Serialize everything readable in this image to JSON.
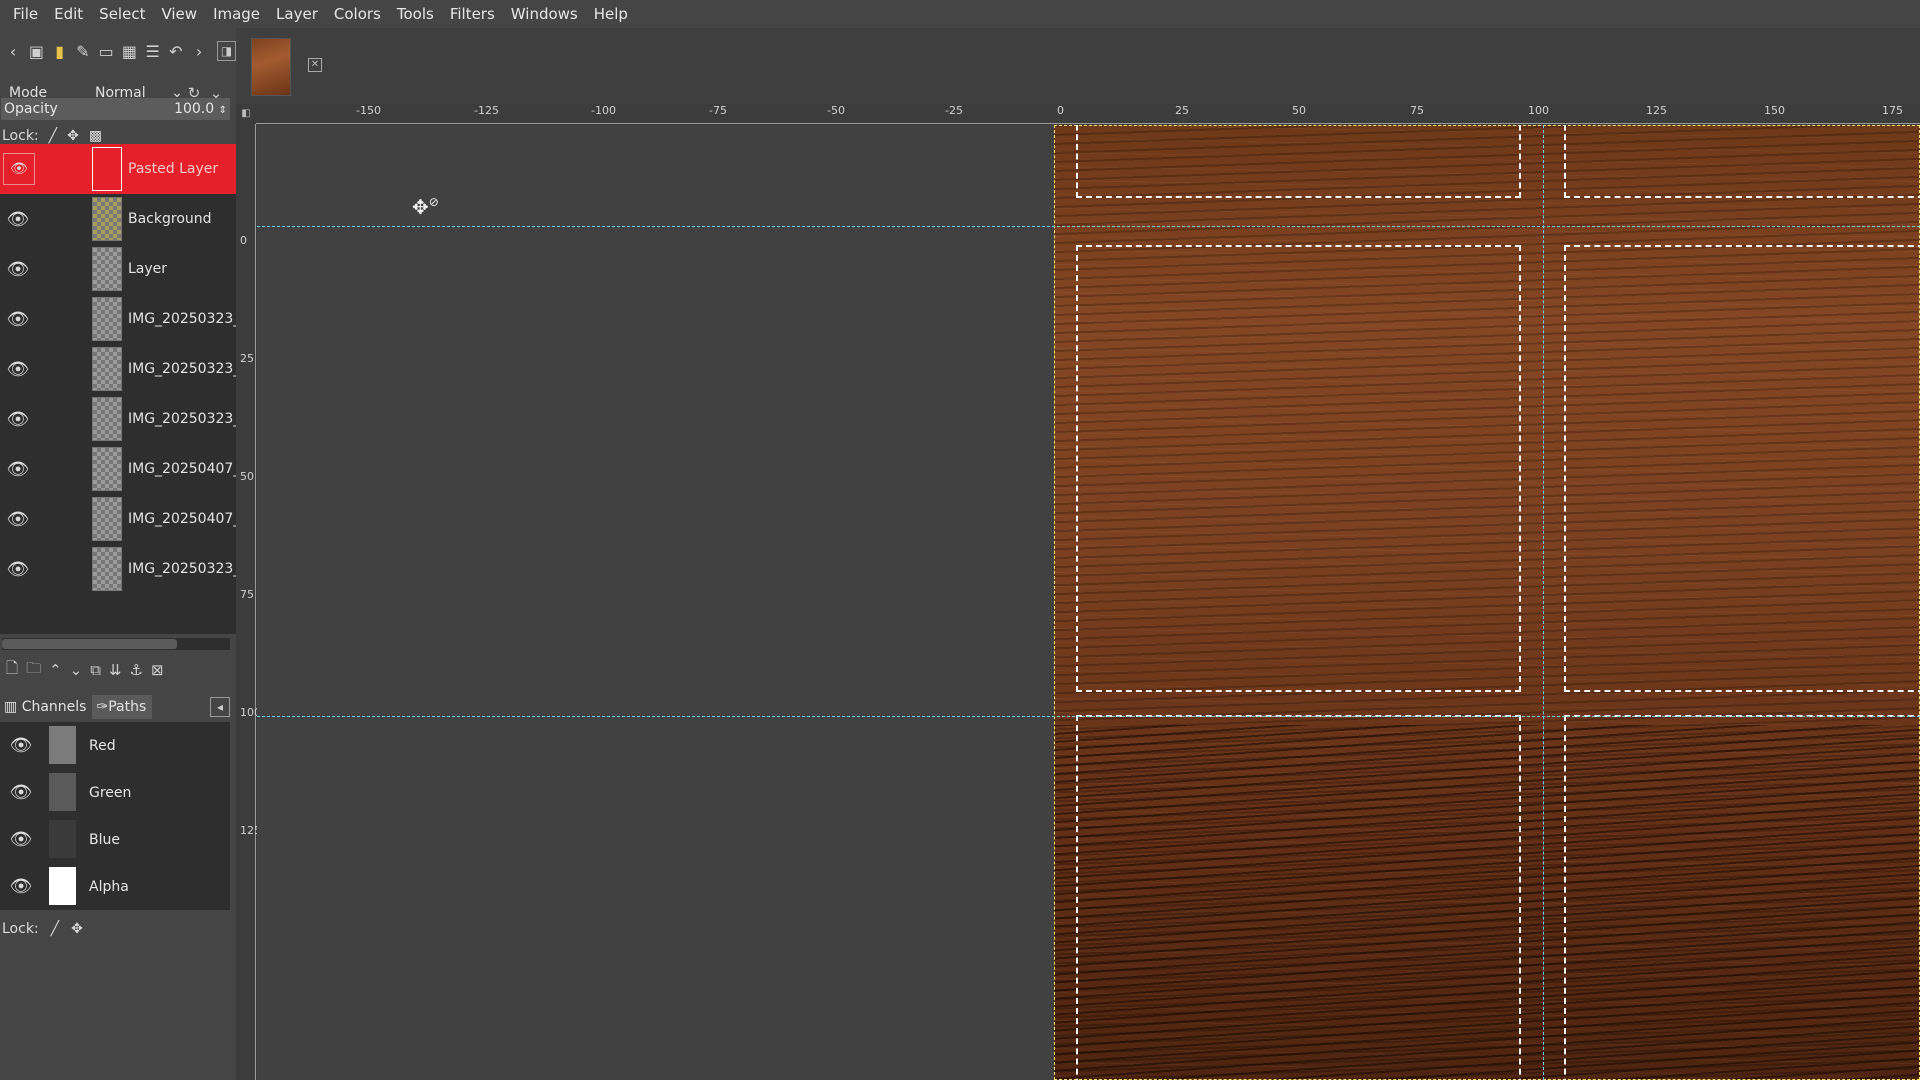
{
  "menu": [
    "File",
    "Edit",
    "Select",
    "View",
    "Image",
    "Layer",
    "Colors",
    "Tools",
    "Filters",
    "Windows",
    "Help"
  ],
  "toolbar_icons": [
    "back-icon",
    "new-image-icon",
    "fg-bg-color-icon",
    "brush-icon",
    "screen-icon",
    "gradient-icon",
    "layers-list-icon",
    "undo-icon",
    "forward-icon"
  ],
  "layers_panel": {
    "mode_label": "Mode",
    "mode_value": "Normal",
    "opacity_label": "Opacity",
    "opacity_value": "100.0",
    "lock_label": "Lock:",
    "layers": [
      {
        "name": "Pasted Layer",
        "active": true
      },
      {
        "name": "Background",
        "active": false
      },
      {
        "name": "Layer",
        "active": false
      },
      {
        "name": "IMG_20250323_",
        "active": false
      },
      {
        "name": "IMG_20250323_",
        "active": false
      },
      {
        "name": "IMG_20250323_",
        "active": false
      },
      {
        "name": "IMG_20250407_",
        "active": false
      },
      {
        "name": "IMG_20250407_",
        "active": false
      },
      {
        "name": "IMG_20250323_",
        "active": false
      }
    ]
  },
  "tabs": {
    "channels": "Channels",
    "paths": "Paths"
  },
  "channels": [
    {
      "name": "Red",
      "color": "#7b7b7b"
    },
    {
      "name": "Green",
      "color": "#5a5a5a"
    },
    {
      "name": "Blue",
      "color": "#3a3a3a"
    },
    {
      "name": "Alpha",
      "color": "#ffffff"
    }
  ],
  "channels_lock_label": "Lock:",
  "ruler_h_labels": [
    "-150",
    "-125",
    "-100",
    "-75",
    "-50",
    "-25",
    "0",
    "25",
    "50",
    "75",
    "100",
    "125",
    "150",
    "175"
  ],
  "ruler_v_labels": [
    "0",
    "25",
    "50",
    "75",
    "100",
    "125"
  ],
  "colors": {
    "active_layer": "#e5202b",
    "guide": "#6ad0ff",
    "selection": "#f3f3f3"
  }
}
